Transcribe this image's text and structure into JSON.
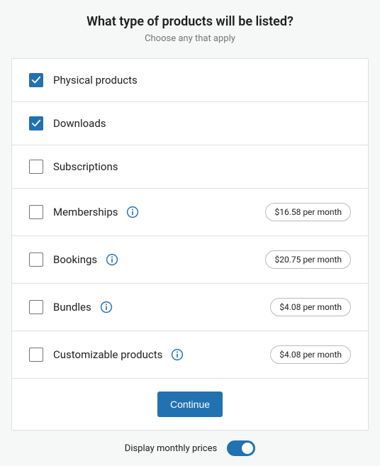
{
  "header": {
    "title": "What type of products will be listed?",
    "subtitle": "Choose any that apply"
  },
  "items": [
    {
      "label": "Physical products",
      "checked": true,
      "info": false,
      "price": null
    },
    {
      "label": "Downloads",
      "checked": true,
      "info": false,
      "price": null
    },
    {
      "label": "Subscriptions",
      "checked": false,
      "info": false,
      "price": null
    },
    {
      "label": "Memberships",
      "checked": false,
      "info": true,
      "price": "$16.58 per month"
    },
    {
      "label": "Bookings",
      "checked": false,
      "info": true,
      "price": "$20.75 per month"
    },
    {
      "label": "Bundles",
      "checked": false,
      "info": true,
      "price": "$4.08 per month"
    },
    {
      "label": "Customizable products",
      "checked": false,
      "info": true,
      "price": "$4.08 per month"
    }
  ],
  "continue_label": "Continue",
  "footer": {
    "label": "Display monthly prices",
    "toggle_on": true
  },
  "colors": {
    "accent": "#2271b1"
  }
}
